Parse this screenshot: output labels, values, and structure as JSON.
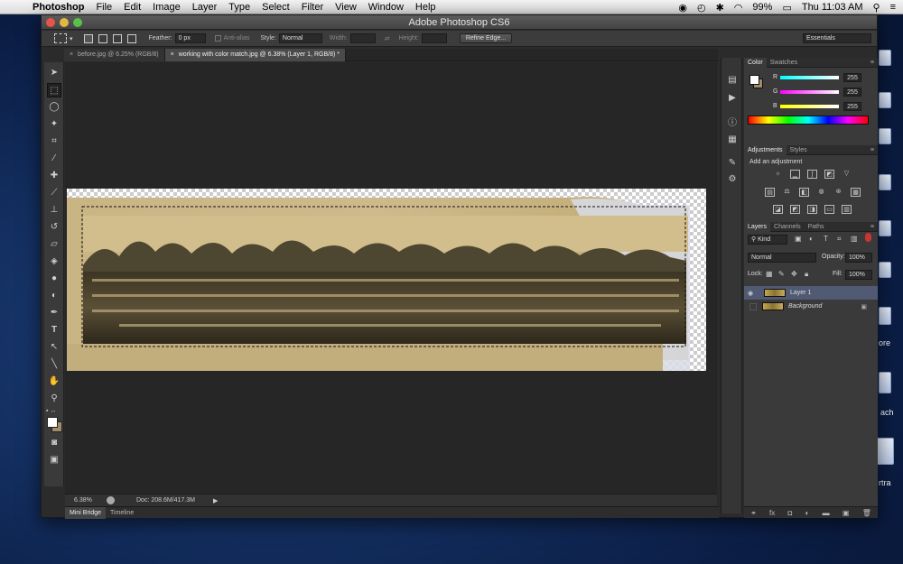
{
  "menubar": {
    "app_name": "Photoshop",
    "items": [
      "File",
      "Edit",
      "Image",
      "Layer",
      "Type",
      "Select",
      "Filter",
      "View",
      "Window",
      "Help"
    ],
    "battery": "99%",
    "clock": "Thu 11:03 AM"
  },
  "window": {
    "title": "Adobe Photoshop CS6"
  },
  "options_bar": {
    "feather_label": "Feather:",
    "feather_value": "0 px",
    "antialias_label": "Anti-alias",
    "style_label": "Style:",
    "style_value": "Normal",
    "width_label": "Width:",
    "height_label": "Height:",
    "refine_edge": "Refine Edge...",
    "workspace": "Essentials"
  },
  "doc_tabs": [
    "before.jpg @ 6.25% (RGB/8)",
    "working with color match.jpg @ 6.38% (Layer 1, RGB/8) *"
  ],
  "status": {
    "zoom": "6.38%",
    "doc_size": "Doc: 208.6M/417.3M"
  },
  "bottom_tabs": [
    "Mini Bridge",
    "Timeline"
  ],
  "color_panel": {
    "tabs": [
      "Color",
      "Swatches"
    ],
    "channels": [
      {
        "label": "R",
        "value": "255"
      },
      {
        "label": "G",
        "value": "255"
      },
      {
        "label": "B",
        "value": "255"
      }
    ]
  },
  "adjustments_panel": {
    "tabs": [
      "Adjustments",
      "Styles"
    ],
    "heading": "Add an adjustment"
  },
  "layers_panel": {
    "tabs": [
      "Layers",
      "Channels",
      "Paths"
    ],
    "kind": "Kind",
    "blend_mode": "Normal",
    "opacity_label": "Opacity:",
    "opacity_value": "100%",
    "lock_label": "Lock:",
    "fill_label": "Fill:",
    "fill_value": "100%",
    "layers": [
      {
        "name": "Layer 1",
        "selected": true
      },
      {
        "name": "Background",
        "selected": false
      }
    ]
  },
  "desktop": {
    "labels": [
      "ore",
      "ach",
      "rtra"
    ]
  }
}
